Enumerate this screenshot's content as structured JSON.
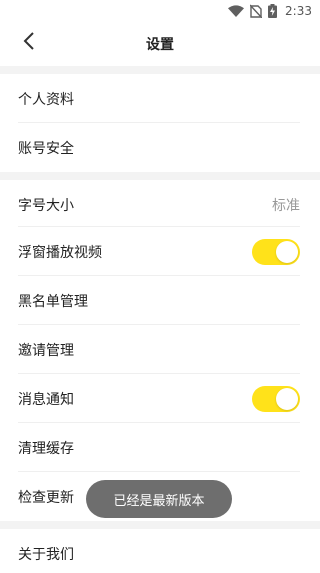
{
  "status_bar": {
    "time": "2:33",
    "icons": [
      "wifi-icon",
      "no-sim-icon",
      "battery-charging-icon"
    ]
  },
  "header": {
    "title": "设置",
    "back_icon": "chevron-left-icon"
  },
  "section1": [
    {
      "label": "个人资料"
    },
    {
      "label": "账号安全"
    }
  ],
  "section2": [
    {
      "label": "字号大小",
      "value": "标准"
    },
    {
      "label": "浮窗播放视频",
      "toggle_on": true
    },
    {
      "label": "黑名单管理"
    },
    {
      "label": "邀请管理"
    },
    {
      "label": "消息通知",
      "toggle_on": true
    },
    {
      "label": "清理缓存"
    },
    {
      "label": "检查更新"
    }
  ],
  "section3": [
    {
      "label": "关于我们"
    }
  ],
  "toast": {
    "text": "已经是最新版本"
  },
  "colors": {
    "toggle_on": "#ffe21a",
    "section_gap": "#f3f3f3",
    "toast_bg": "#6e6e6e"
  }
}
